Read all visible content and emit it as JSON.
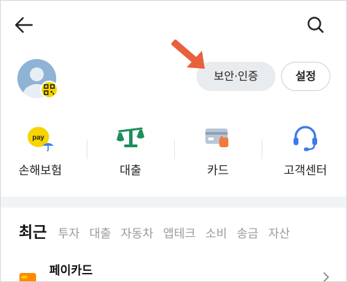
{
  "header": {
    "back_icon": "back-arrow-icon",
    "search_icon": "search-icon"
  },
  "profile": {
    "avatar_icon": "avatar-icon",
    "qr_icon": "qr-code-icon"
  },
  "buttons": {
    "security_label": "보안·인증",
    "settings_label": "설정"
  },
  "annotation": {
    "arrow_icon": "pointer-arrow-icon",
    "arrow_color": "#e8603c"
  },
  "quick_menu": [
    {
      "label": "손해보험",
      "icon": "pay-umbrella-icon"
    },
    {
      "label": "대출",
      "icon": "scale-icon"
    },
    {
      "label": "카드",
      "icon": "card-icon"
    },
    {
      "label": "고객센터",
      "icon": "headset-icon"
    }
  ],
  "pay_badge_text": "pay",
  "tabs": [
    "최근",
    "투자",
    "대출",
    "자동차",
    "앱테크",
    "소비",
    "송금",
    "자산"
  ],
  "list": {
    "first_item_title": "페이카드"
  },
  "colors": {
    "kakao_yellow": "#f5d400",
    "green": "#1d8f5a",
    "blue": "#3b7bea",
    "avatar": "#8eb3d4"
  }
}
